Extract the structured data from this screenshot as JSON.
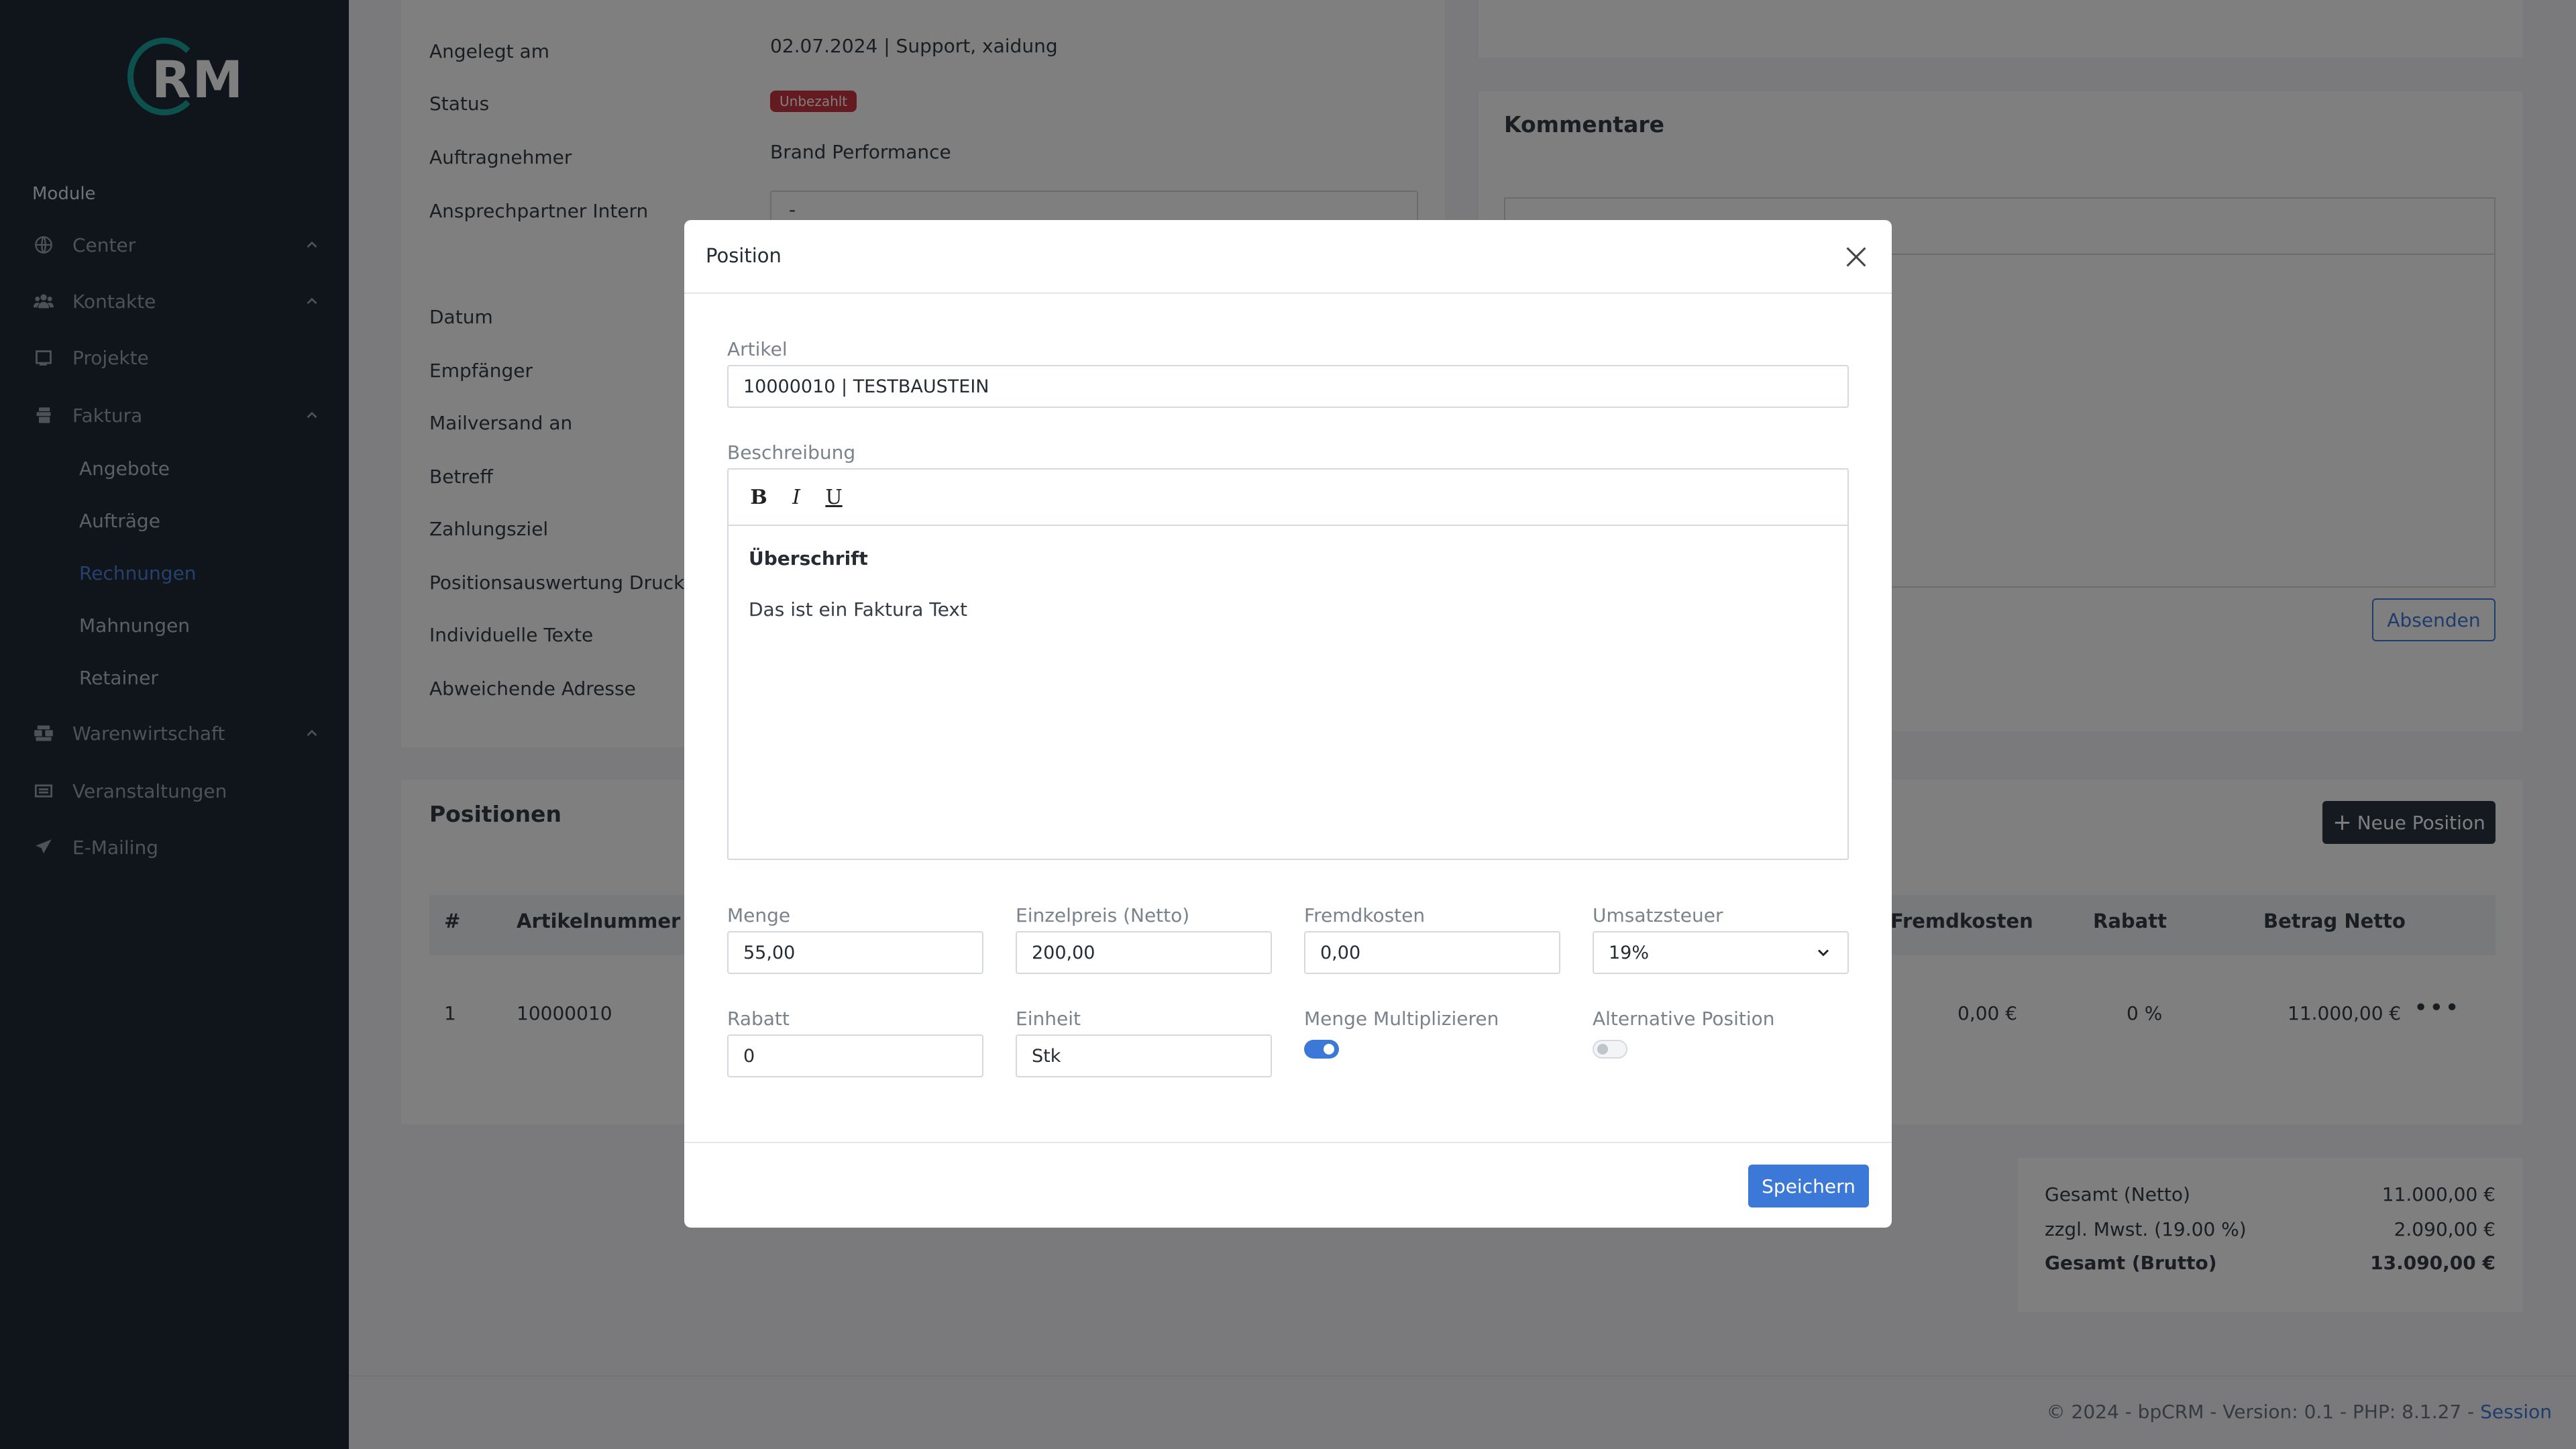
{
  "brand": {
    "logo_text": "RM"
  },
  "sidebar": {
    "module_title": "Module",
    "items": [
      {
        "label": "Center",
        "icon": "globe-icon",
        "has_chevron": true
      },
      {
        "label": "Kontakte",
        "icon": "users-icon",
        "has_chevron": true
      },
      {
        "label": "Projekte",
        "icon": "book-icon",
        "has_chevron": false
      },
      {
        "label": "Faktura",
        "icon": "files-icon",
        "has_chevron": true
      },
      {
        "label": "Warenwirtschaft",
        "icon": "boxes-icon",
        "has_chevron": true
      },
      {
        "label": "Veranstaltungen",
        "icon": "ticket-icon",
        "has_chevron": false
      },
      {
        "label": "E-Mailing",
        "icon": "send-icon",
        "has_chevron": false
      }
    ],
    "faktura_sub": [
      "Angebote",
      "Aufträge",
      "Rechnungen",
      "Mahnungen",
      "Retainer"
    ],
    "active_sub": "Rechnungen"
  },
  "invoice": {
    "fields": [
      {
        "label": "Angelegt am",
        "value": "02.07.2024 | Support, xaidung"
      },
      {
        "label": "Status",
        "value": "Unbezahlt"
      },
      {
        "label": "Auftragnehmer",
        "value": "Brand Performance"
      },
      {
        "label": "Ansprechpartner Intern",
        "value": "-"
      },
      {
        "label": "Datum"
      },
      {
        "label": "Empfänger"
      },
      {
        "label": "Mailversand an"
      },
      {
        "label": "Betreff"
      },
      {
        "label": "Zahlungsziel"
      },
      {
        "label": "Positionsauswertung Drucken"
      },
      {
        "label": "Individuelle Texte"
      },
      {
        "label": "Abweichende Adresse"
      }
    ]
  },
  "comments": {
    "title": "Kommentare",
    "submit_label": "Absenden"
  },
  "positions": {
    "title": "Positionen",
    "new_label": "Neue Position",
    "columns": [
      "#",
      "Artikelnummer",
      "Fremdkosten",
      "Rabatt",
      "Betrag Netto"
    ],
    "rows": [
      {
        "num": "1",
        "artikelnummer": "10000010",
        "fremdkosten": "0,00 €",
        "rabatt": "0 %",
        "betrag": "11.000,00 €"
      }
    ]
  },
  "totals": {
    "netto_label": "Gesamt (Netto)",
    "netto_value": "11.000,00 €",
    "mwst_label": "zzgl. Mwst. (19.00 %)",
    "mwst_value": "2.090,00 €",
    "brutto_label": "Gesamt (Brutto)",
    "brutto_value": "13.090,00 €"
  },
  "footer": {
    "text": "© 2024 - bpCRM - Version: 0.1 - PHP: 8.1.27 -",
    "link": "Session"
  },
  "modal": {
    "title": "Position",
    "artikel_label": "Artikel",
    "artikel_value": "10000010 | TESTBAUSTEIN",
    "beschreibung_label": "Beschreibung",
    "editor_heading": "Überschrift",
    "editor_text": "Das ist ein Faktura Text",
    "menge_label": "Menge",
    "menge_value": "55,00",
    "einzelpreis_label": "Einzelpreis (Netto)",
    "einzelpreis_value": "200,00",
    "fremdkosten_label": "Fremdkosten",
    "fremdkosten_value": "0,00",
    "umsatzsteuer_label": "Umsatzsteuer",
    "umsatzsteuer_value": "19%",
    "rabatt_label": "Rabatt",
    "rabatt_value": "0",
    "einheit_label": "Einheit",
    "einheit_value": "Stk",
    "menge_mult_label": "Menge Multiplizieren",
    "menge_mult_on": true,
    "alt_pos_label": "Alternative Position",
    "alt_pos_on": false,
    "save_label": "Speichern"
  },
  "colors": {
    "sidebar_bg": "#1f2a36",
    "accent": "#3c78d8",
    "logo_accent": "#1aa39c",
    "badge_red": "#c9343c"
  }
}
